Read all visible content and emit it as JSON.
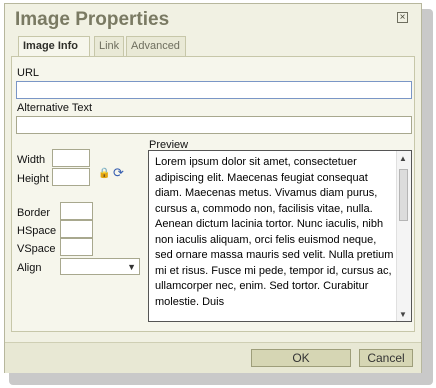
{
  "dialog": {
    "title": "Image Properties",
    "close_icon": "close-icon"
  },
  "tabs": [
    {
      "label": "Image Info",
      "active": true
    },
    {
      "label": "Link",
      "active": false
    },
    {
      "label": "Advanced",
      "active": false
    }
  ],
  "form": {
    "url_label": "URL",
    "url_value": "",
    "alt_label": "Alternative Text",
    "alt_value": "",
    "width_label": "Width",
    "height_label": "Height",
    "border_label": "Border",
    "hspace_label": "HSpace",
    "vspace_label": "VSpace",
    "align_label": "Align",
    "align_value": "",
    "lock_icon": "lock-icon",
    "reset_icon": "refresh-icon"
  },
  "preview": {
    "label": "Preview",
    "text": "Lorem ipsum dolor sit amet, consectetuer adipiscing elit. Maecenas feugiat consequat diam. Maecenas metus. Vivamus diam purus, cursus a, commodo non, facilisis vitae, nulla. Aenean dictum lacinia tortor. Nunc iaculis, nibh non iaculis aliquam, orci felis euismod neque, sed ornare massa mauris sed velit. Nulla pretium mi et risus. Fusce mi pede, tempor id, cursus ac, ullamcorper nec, enim. Sed tortor. Curabitur molestie. Duis"
  },
  "buttons": {
    "ok": "OK",
    "cancel": "Cancel"
  },
  "colors": {
    "title": "#7a7a63",
    "dialog_bg": "#f1f1e3",
    "button_bg": "#d6d6b4"
  }
}
